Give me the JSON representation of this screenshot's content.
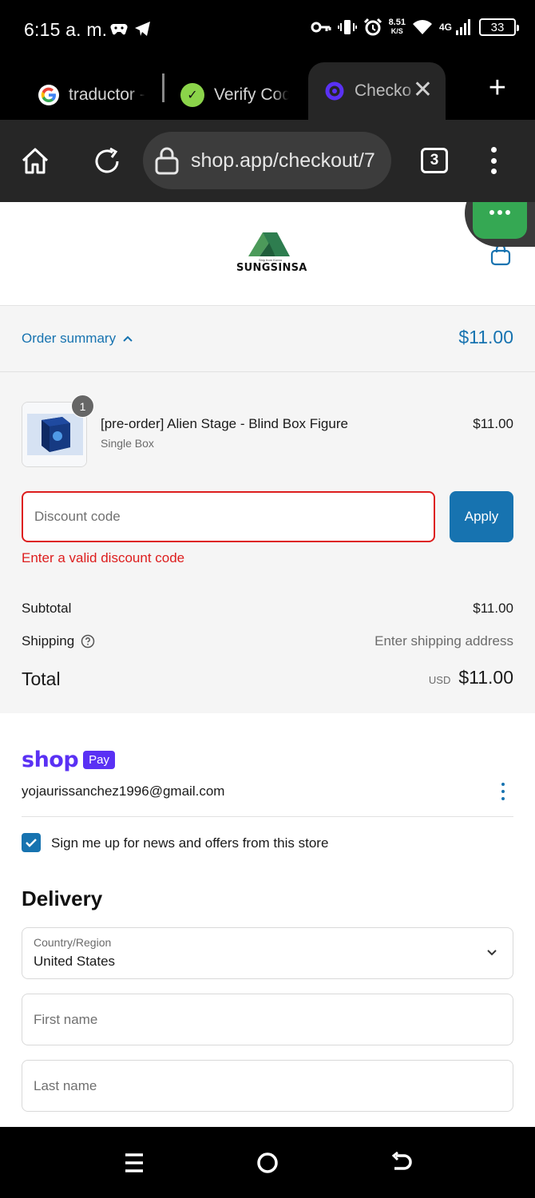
{
  "status_bar": {
    "time": "6:15 a. m.",
    "speed_value": "8.51",
    "speed_unit": "K/S",
    "network": "4G",
    "battery": "33"
  },
  "browser": {
    "tabs": [
      {
        "label": "traductor -",
        "favicon": "google-icon"
      },
      {
        "label": "Verify Cod",
        "favicon": "verify-app-icon"
      },
      {
        "label": "Checko",
        "favicon": "shop-icon",
        "active": true
      }
    ],
    "url": "shop.app/checkout/7",
    "tab_count": "3"
  },
  "store": {
    "name": "SUNGSINSA",
    "tagline": "Ship from Korea",
    "brand_color": "#2e7d4f"
  },
  "order_summary": {
    "toggle_label": "Order summary",
    "total": "$11.00",
    "item": {
      "quantity": "1",
      "title": "[pre-order] Alien Stage - Blind Box Figure",
      "variant": "Single Box",
      "price": "$11.00"
    },
    "discount": {
      "placeholder": "Discount code",
      "value": "",
      "apply_label": "Apply",
      "error": "Enter a valid discount code"
    },
    "subtotal_label": "Subtotal",
    "subtotal_value": "$11.00",
    "shipping_label": "Shipping",
    "shipping_value": "Enter shipping address",
    "total_label": "Total",
    "total_currency": "USD",
    "total_value": "$11.00"
  },
  "contact": {
    "shop_word": "shop",
    "pay_badge": "Pay",
    "email": "yojaurissanchez1996@gmail.com",
    "newsletter_label": "Sign me up for news and offers from this store",
    "newsletter_checked": true
  },
  "delivery": {
    "title": "Delivery",
    "country_label": "Country/Region",
    "country_value": "United States",
    "first_name_placeholder": "First name",
    "last_name_placeholder": "Last name"
  },
  "colors": {
    "accent": "#1773b0",
    "error": "#dd1d1d",
    "shop_pay": "#5a31f4"
  }
}
